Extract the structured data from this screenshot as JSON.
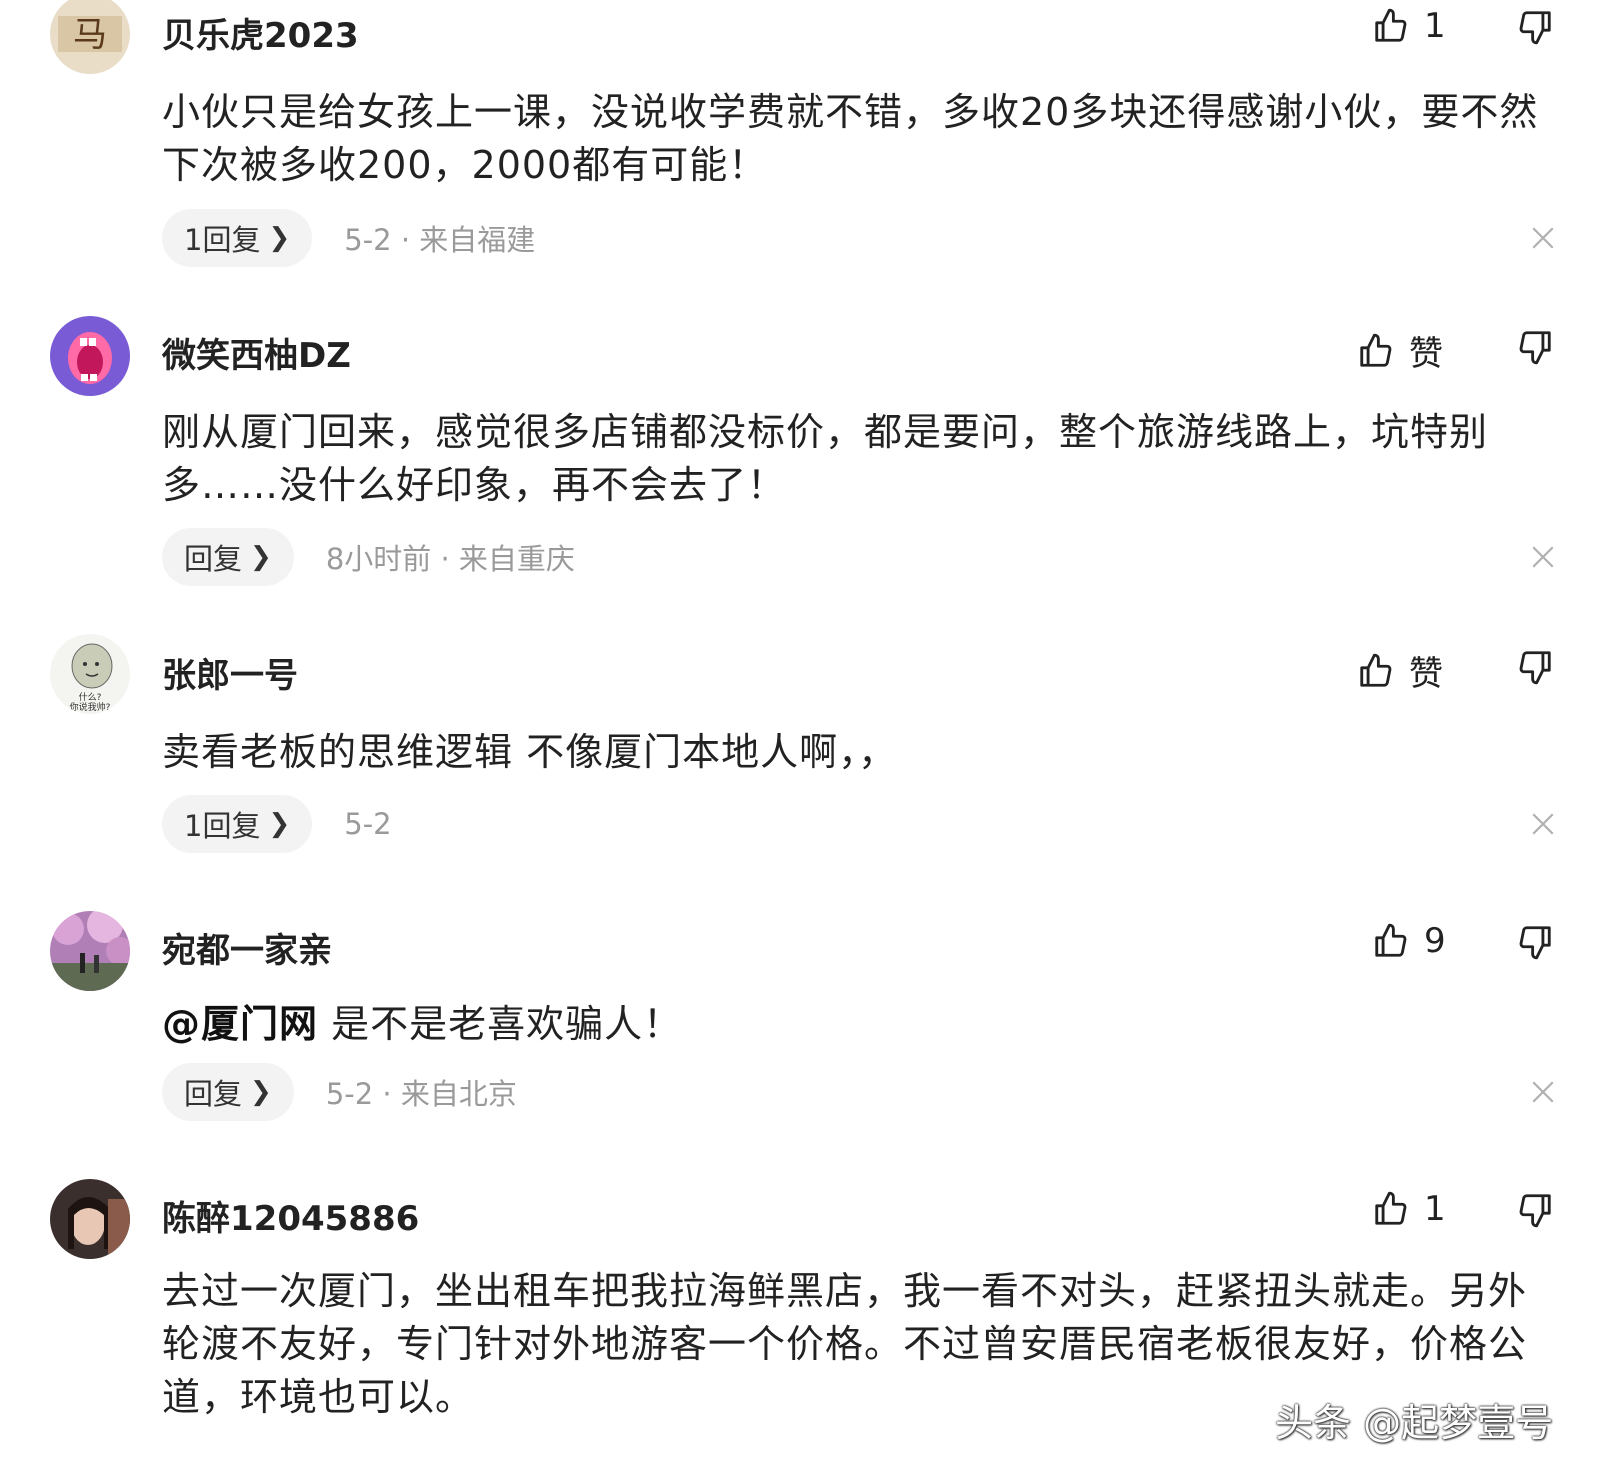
{
  "comments": [
    {
      "user": "贝乐虎2023",
      "avatar": "poster-avatar",
      "likes": "1",
      "text": "小伙只是给女孩上一课，没说收学费就不错，多收20多块还得感谢小伙，要不然下次被多收200，2000都有可能！",
      "replies": "1回复",
      "time": "5-2",
      "location": "来自福建"
    },
    {
      "user": "微笑西柚DZ",
      "avatar": "cartoon-mouth-avatar",
      "likes": "赞",
      "text": "刚从厦门回来，感觉很多店铺都没标价，都是要问，整个旅游线路上，坑特别多……没什么好印象，再不会去了！",
      "replies": "回复",
      "time": "8小时前",
      "location": "来自重庆"
    },
    {
      "user": "张郎一号",
      "avatar": "meme-face-avatar",
      "likes": "赞",
      "text": "卖看老板的思维逻辑 不像厦门本地人啊，，",
      "replies": "1回复",
      "time": "5-2",
      "location": ""
    },
    {
      "user": "宛都一家亲",
      "avatar": "cherry-blossom-avatar",
      "likes": "9",
      "mention": "@厦门网",
      "text": " 是不是老喜欢骗人！",
      "replies": "回复",
      "time": "5-2",
      "location": "来自北京"
    },
    {
      "user": "陈醉12045886",
      "avatar": "portrait-avatar",
      "likes": "1",
      "text": "去过一次厦门，坐出租车把我拉海鲜黑店，我一看不对头，赶紧扭头就走。另外轮渡不友好，专门针对外地游客一个价格。不过曾安厝民宿老板很友好，价格公道，环境也可以。"
    }
  ],
  "separator": "·",
  "icons": {
    "like": "thumbs-up-icon",
    "dislike": "thumbs-down-icon",
    "close": "close-icon",
    "chevron": "chevron-right-icon"
  },
  "watermark": "头条 @起梦壹号"
}
